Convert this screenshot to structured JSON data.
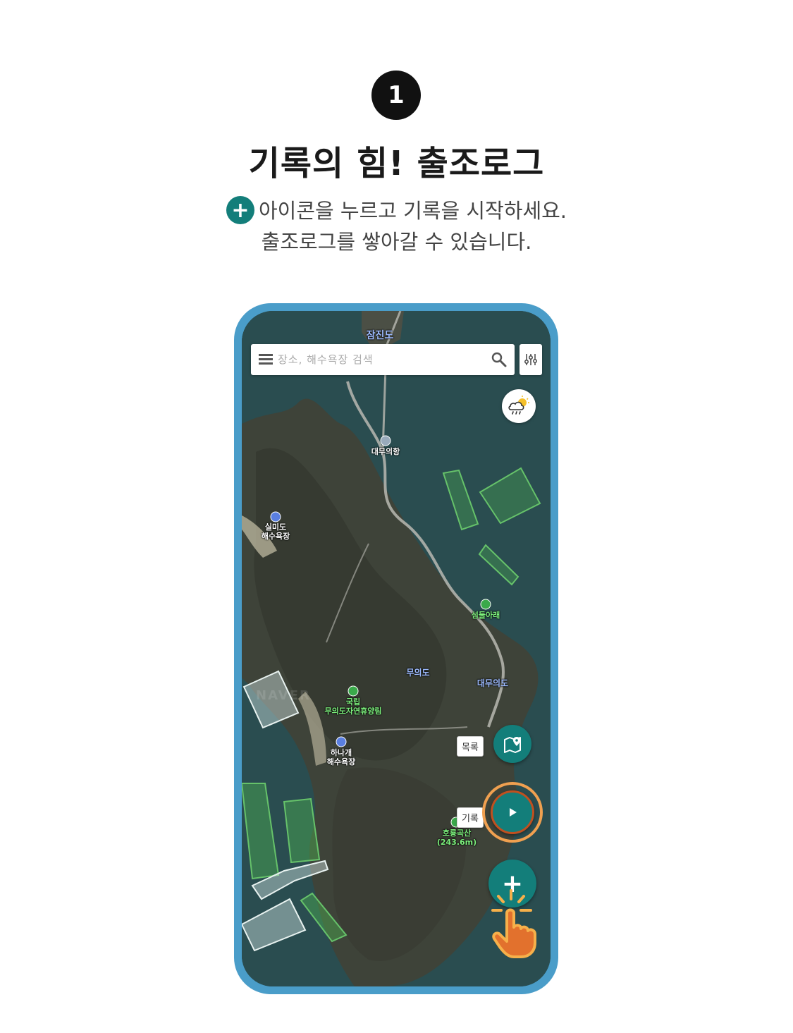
{
  "step": {
    "number": "1"
  },
  "headline": "기록의 힘! 출조로그",
  "description": {
    "plus_glyph": "+",
    "line1": "아이콘을 누르고 기록을 시작하세요.",
    "line2": "출조로그를 쌓아갈 수 있습니다."
  },
  "search": {
    "placeholder": "장소, 해수욕장 검색"
  },
  "map": {
    "labels": {
      "top_island": "잠진도",
      "port": "대무의항",
      "beach1_line1": "실미도",
      "beach1_line2": "해수욕장",
      "trail": "섬둘아래",
      "island": "무의도",
      "area": "대무의도",
      "forest_line1": "국립",
      "forest_line2": "무의도자연휴양림",
      "beach2_line1": "하나개",
      "beach2_line2": "해수욕장",
      "peak_line1": "호룡곡산",
      "peak_line2": "(243.6m)",
      "watermark": "NAVER"
    }
  },
  "buttons": {
    "list_label": "목록",
    "record_label": "기록",
    "add_glyph": "+"
  },
  "colors": {
    "accent": "#137e7a",
    "frame": "#4a9dc9",
    "highlight": "#f0a050",
    "zone_green": "#4caf50"
  }
}
